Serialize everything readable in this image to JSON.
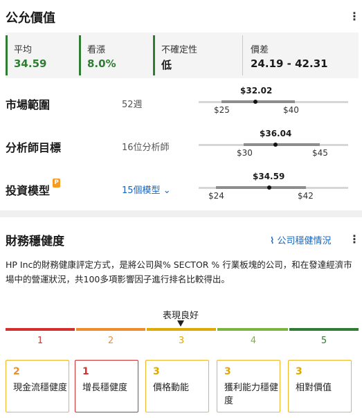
{
  "fair_value": {
    "title": "公允價值",
    "metrics": [
      {
        "label": "平均",
        "value": "34.59"
      },
      {
        "label": "看漲",
        "value": "8.0%"
      },
      {
        "label": "不確定性",
        "value": "低"
      },
      {
        "label": "價差",
        "value": "24.19 - 42.31"
      }
    ],
    "rows": [
      {
        "label": "市場範圍",
        "sub": "52週",
        "current": "$32.02",
        "low": "$25",
        "high": "$40"
      },
      {
        "label": "分析師目標",
        "sub": "16位分析師",
        "current": "$36.04",
        "low": "$30",
        "high": "$45"
      },
      {
        "label": "投資模型",
        "sub": "15個模型",
        "sub_caret": "⌄",
        "current": "$34.59",
        "low": "$24",
        "high": "$42"
      }
    ],
    "pro_badge": "P"
  },
  "financial_health": {
    "title": "財務穩健度",
    "link_icon": "⌇",
    "link_label": "公司穩健情況",
    "description": "HP Inc的財務健康評定方式，是將公司與% SECTOR % 行業板塊的公司，和在發達經濟市場中的營運狀況，共100多項影響因子進行排名比較得出。",
    "performance_label": "表現良好",
    "performance_level": 3,
    "scale": [
      {
        "num": "1",
        "color": "#d32f2f"
      },
      {
        "num": "2",
        "color": "#f08c2e"
      },
      {
        "num": "3",
        "color": "#e0a800"
      },
      {
        "num": "4",
        "color": "#7cb342"
      },
      {
        "num": "5",
        "color": "#2e7d32"
      }
    ],
    "scores": [
      {
        "score": "2",
        "name": "現金流穩健度",
        "color": "#f08c2e"
      },
      {
        "score": "1",
        "name": "增長穩健度",
        "color": "#d32f2f"
      },
      {
        "score": "3",
        "name": "價格動能",
        "color": "#e0a800"
      },
      {
        "score": "3",
        "name": "獲利能力穩健度",
        "color": "#e0a800"
      },
      {
        "score": "3",
        "name": "相對價值",
        "color": "#e0a800"
      }
    ]
  }
}
